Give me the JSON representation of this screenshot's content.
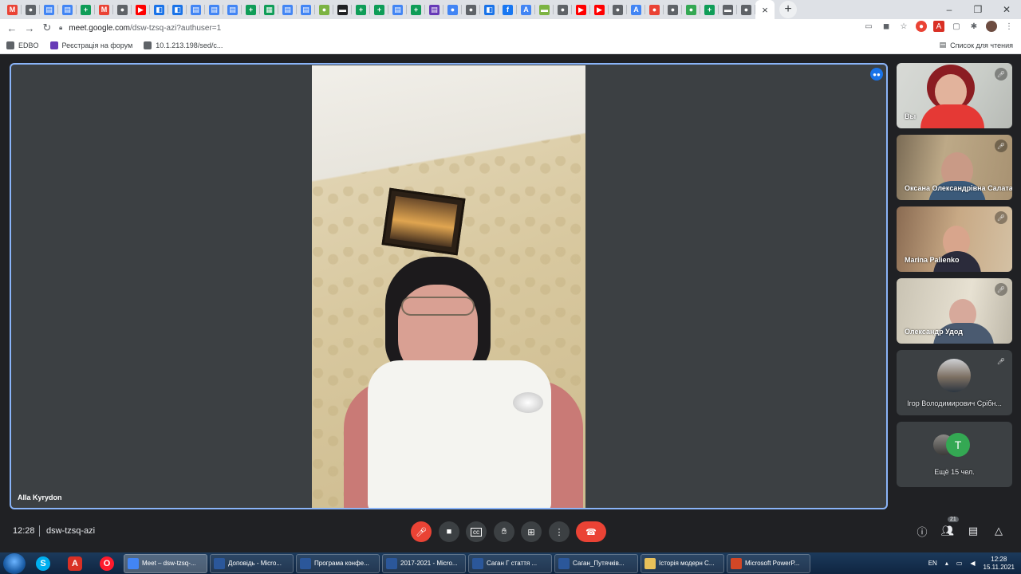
{
  "browser": {
    "tabs": [
      {
        "icon": "gmail-icon",
        "color": "#ea4335",
        "glyph": "M"
      },
      {
        "icon": "chrome-icon",
        "color": "#5f6368",
        "glyph": "●"
      },
      {
        "icon": "docs-icon",
        "color": "#4285f4",
        "glyph": "▤"
      },
      {
        "icon": "docs-icon",
        "color": "#4285f4",
        "glyph": "▤"
      },
      {
        "icon": "classroom-icon",
        "color": "#0f9d58",
        "glyph": "+"
      },
      {
        "icon": "gmail-icon",
        "color": "#ea4335",
        "glyph": "M"
      },
      {
        "icon": "chrome-icon",
        "color": "#5f6368",
        "glyph": "●"
      },
      {
        "icon": "youtube-icon",
        "color": "#ff0000",
        "glyph": "▶"
      },
      {
        "icon": "meet-icon",
        "color": "#1a73e8",
        "glyph": "◧"
      },
      {
        "icon": "meet-icon",
        "color": "#1a73e8",
        "glyph": "◧"
      },
      {
        "icon": "docs-icon",
        "color": "#4285f4",
        "glyph": "▤"
      },
      {
        "icon": "docs-icon",
        "color": "#4285f4",
        "glyph": "▤"
      },
      {
        "icon": "docs-icon",
        "color": "#4285f4",
        "glyph": "▤"
      },
      {
        "icon": "classroom-icon",
        "color": "#0f9d58",
        "glyph": "+"
      },
      {
        "icon": "slides-icon",
        "color": "#0f9d58",
        "glyph": "▦"
      },
      {
        "icon": "docs-icon",
        "color": "#4285f4",
        "glyph": "▤"
      },
      {
        "icon": "docs-icon",
        "color": "#4285f4",
        "glyph": "▤"
      },
      {
        "icon": "lime-icon",
        "color": "#7cb342",
        "glyph": "●"
      },
      {
        "icon": "site-icon",
        "color": "#202124",
        "glyph": "▬"
      },
      {
        "icon": "classroom-icon",
        "color": "#0f9d58",
        "glyph": "+"
      },
      {
        "icon": "classroom-icon",
        "color": "#0f9d58",
        "glyph": "+"
      },
      {
        "icon": "docs-icon",
        "color": "#4285f4",
        "glyph": "▤"
      },
      {
        "icon": "classroom-icon",
        "color": "#0f9d58",
        "glyph": "+"
      },
      {
        "icon": "forms-icon",
        "color": "#673ab7",
        "glyph": "▤"
      },
      {
        "icon": "site-icon",
        "color": "#4285f4",
        "glyph": "●"
      },
      {
        "icon": "chrome-icon",
        "color": "#5f6368",
        "glyph": "●"
      },
      {
        "icon": "meet-icon",
        "color": "#1a73e8",
        "glyph": "◧"
      },
      {
        "icon": "facebook-icon",
        "color": "#1877f2",
        "glyph": "f"
      },
      {
        "icon": "translate-icon",
        "color": "#4285f4",
        "glyph": "A"
      },
      {
        "icon": "site-icon",
        "color": "#7cb342",
        "glyph": "▬"
      },
      {
        "icon": "chrome-icon",
        "color": "#5f6368",
        "glyph": "●"
      },
      {
        "icon": "youtube-icon",
        "color": "#ff0000",
        "glyph": "▶"
      },
      {
        "icon": "youtube-icon",
        "color": "#ff0000",
        "glyph": "▶"
      },
      {
        "icon": "chrome-icon",
        "color": "#5f6368",
        "glyph": "●"
      },
      {
        "icon": "translate-icon",
        "color": "#4285f4",
        "glyph": "A"
      },
      {
        "icon": "site-icon",
        "color": "#ea4335",
        "glyph": "●"
      },
      {
        "icon": "chrome-icon",
        "color": "#5f6368",
        "glyph": "●"
      },
      {
        "icon": "site-icon",
        "color": "#34a853",
        "glyph": "●"
      },
      {
        "icon": "classroom-icon",
        "color": "#0f9d58",
        "glyph": "+"
      },
      {
        "icon": "site-icon",
        "color": "#5f6368",
        "glyph": "▬"
      },
      {
        "icon": "chrome-icon",
        "color": "#5f6368",
        "glyph": "●"
      }
    ],
    "active_tab_close": "×",
    "new_tab": "+",
    "window_controls": {
      "minimize": "–",
      "maximize": "❐",
      "close": "✕"
    },
    "address": {
      "host": "meet.google.com",
      "path": "/dsw-tzsq-azi?authuser=1"
    },
    "bookmarks": [
      {
        "label": "EDBO",
        "color": "#5f6368"
      },
      {
        "label": "Реєстрація на форум",
        "color": "#673ab7"
      },
      {
        "label": "10.1.213.198/sed/c...",
        "color": "#5f6368"
      }
    ],
    "reading_list": "Список для чтения"
  },
  "meet": {
    "main_speaker": "Alla Kyrydon",
    "participants": [
      {
        "name": "Вы",
        "muted": true
      },
      {
        "name": "Оксана Олександрівна Салата",
        "muted": true
      },
      {
        "name": "Marina Palienko",
        "muted": true
      },
      {
        "name": "Олександр Удод",
        "muted": true
      },
      {
        "name": "Ігор Володимирович Срібн...",
        "muted": true
      }
    ],
    "more": {
      "avatar_letter": "T",
      "label": "Ещё 15 чел.",
      "avatar_color": "#34a853"
    },
    "time": "12:28",
    "meeting_code": "dsw-tzsq-azi",
    "participant_count": "21"
  },
  "taskbar": {
    "tasks": [
      {
        "label": "Meet – dsw-tzsq-...",
        "color": "#4285f4",
        "active": true
      },
      {
        "label": "Доповідь - Micro...",
        "color": "#2b579a",
        "active": false
      },
      {
        "label": "Програма конфе...",
        "color": "#2b579a",
        "active": false
      },
      {
        "label": "2017-2021 - Micro...",
        "color": "#2b579a",
        "active": false
      },
      {
        "label": "Саган Г стаття ...",
        "color": "#2b579a",
        "active": false
      },
      {
        "label": "Саган_Путячків...",
        "color": "#2b579a",
        "active": false
      },
      {
        "label": "Історія модерн С...",
        "color": "#e8c15a",
        "active": false
      },
      {
        "label": "Microsoft PowerP...",
        "color": "#d24726",
        "active": false
      }
    ],
    "lang": "EN",
    "time": "12:28",
    "date": "15.11.2021"
  }
}
